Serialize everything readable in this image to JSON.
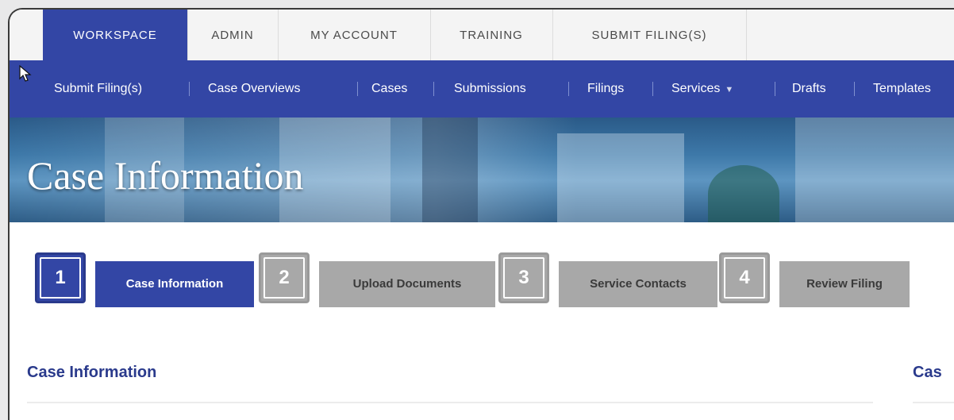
{
  "top_tabs": [
    "WORKSPACE",
    "ADMIN",
    "MY ACCOUNT",
    "TRAINING",
    "SUBMIT FILING(S)"
  ],
  "subnav": {
    "items": [
      "Submit Filing(s)",
      "Case Overviews",
      "Cases",
      "Submissions",
      "Filings",
      "Services",
      "Drafts",
      "Templates"
    ],
    "dropdown_item": "Services"
  },
  "banner": {
    "title": "Case Information"
  },
  "steps": [
    {
      "number": "1",
      "label": "Case Information",
      "state": "active"
    },
    {
      "number": "2",
      "label": "Upload Documents",
      "state": "inactive"
    },
    {
      "number": "3",
      "label": "Service Contacts",
      "state": "inactive"
    },
    {
      "number": "4",
      "label": "Review Filing",
      "state": "inactive"
    }
  ],
  "sections": {
    "left_title": "Case Information",
    "right_title_partial": "Cas"
  },
  "colors": {
    "primary": "#3346a5",
    "inactive_step": "#a8a8a8",
    "section_title": "#2a3a8c"
  }
}
